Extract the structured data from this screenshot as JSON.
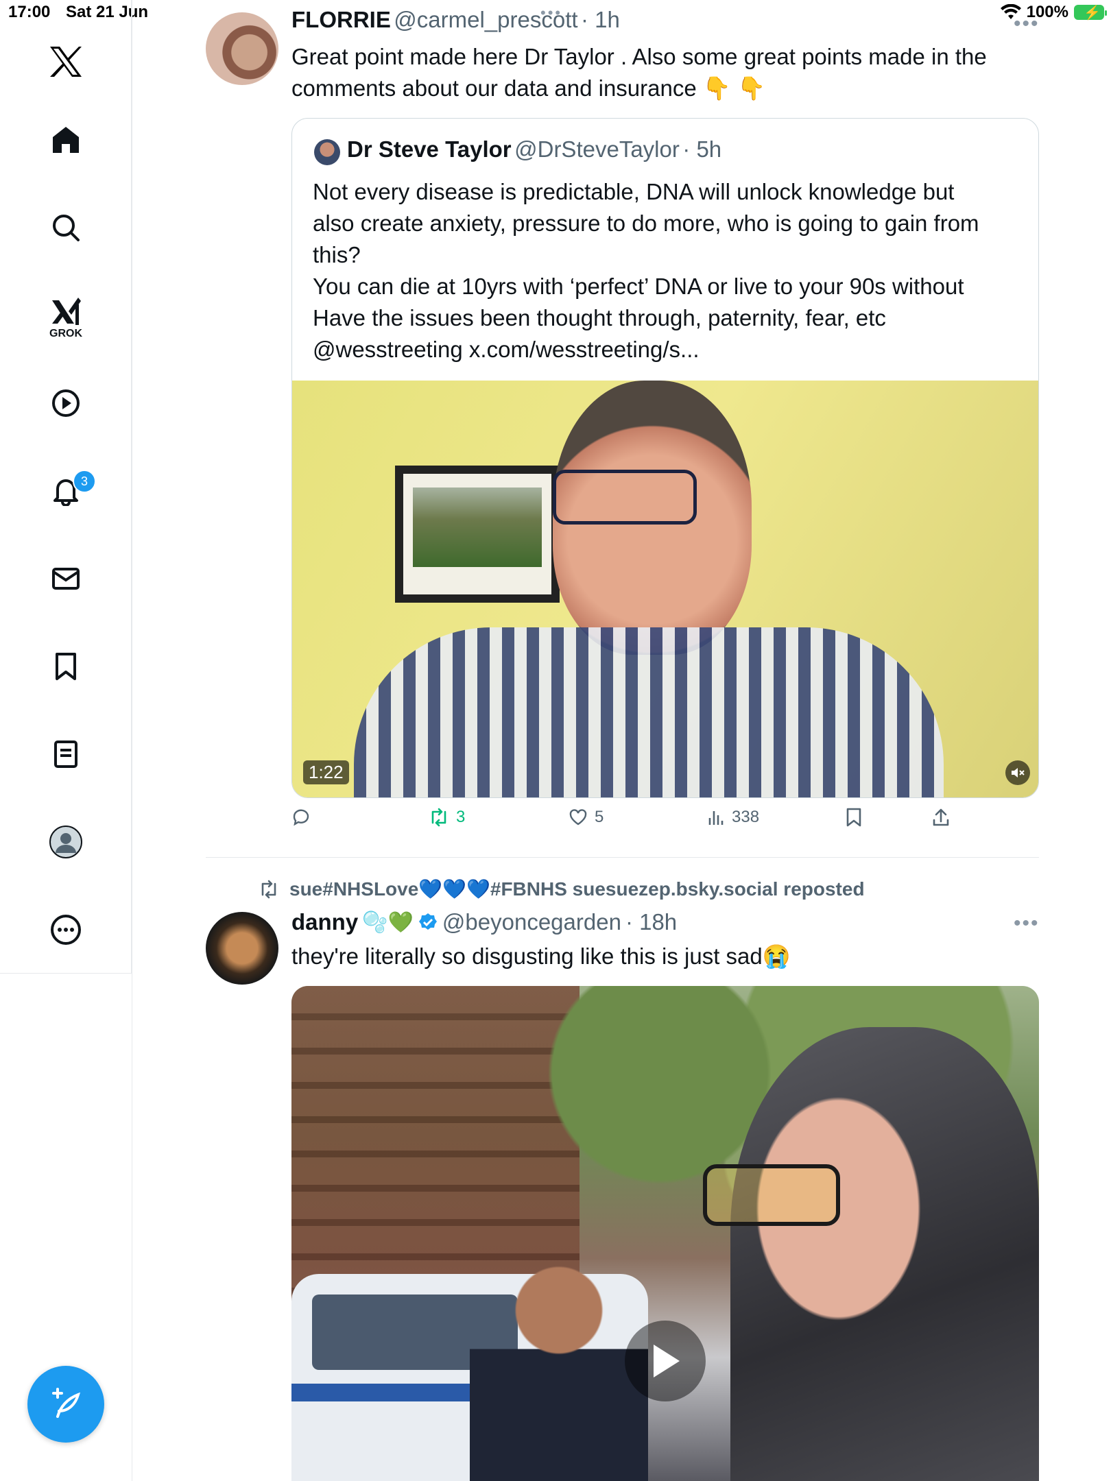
{
  "status_bar": {
    "time": "17:00",
    "date": "Sat 21 Jun",
    "battery": "100%"
  },
  "sidebar": {
    "grok_label": "GROK",
    "notifications_badge": "3"
  },
  "tweet1": {
    "name": "FLORRIE",
    "handle": "@carmel_prescott",
    "time": "· 1h",
    "text_line1": "Great point made here Dr Taylor . Also some great points made in the",
    "text_line2": "comments about our data and insurance",
    "emojis": "👇 👇",
    "quote": {
      "name": "Dr Steve Taylor",
      "handle": "@DrSteveTaylor",
      "time": "· 5h",
      "lines": [
        "Not every disease is predictable, DNA will unlock knowledge but",
        "also create anxiety, pressure to do more, who is going to gain from",
        "this?",
        "You can die at 10yrs with ‘perfect’ DNA or live to your 90s without",
        "Have the issues been thought through, paternity, fear, etc",
        "@wesstreeting x.com/wesstreeting/s..."
      ],
      "video_duration": "1:22"
    },
    "actions": {
      "replies": "",
      "reposts": "3",
      "likes": "5",
      "views": "338"
    }
  },
  "tweet2": {
    "repost_label": "sue#NHSLove💙💙💙#FBNHS suesuezep.bsky.social reposted",
    "name": "danny",
    "name_emoji": "🫧💚",
    "handle": "@beyoncegarden",
    "time": "· 18h",
    "text": "they're literally so disgusting like this is just sad😭"
  },
  "colors": {
    "accent": "#1d9bf0",
    "repost_green": "#00ba7c",
    "muted": "#536471"
  }
}
